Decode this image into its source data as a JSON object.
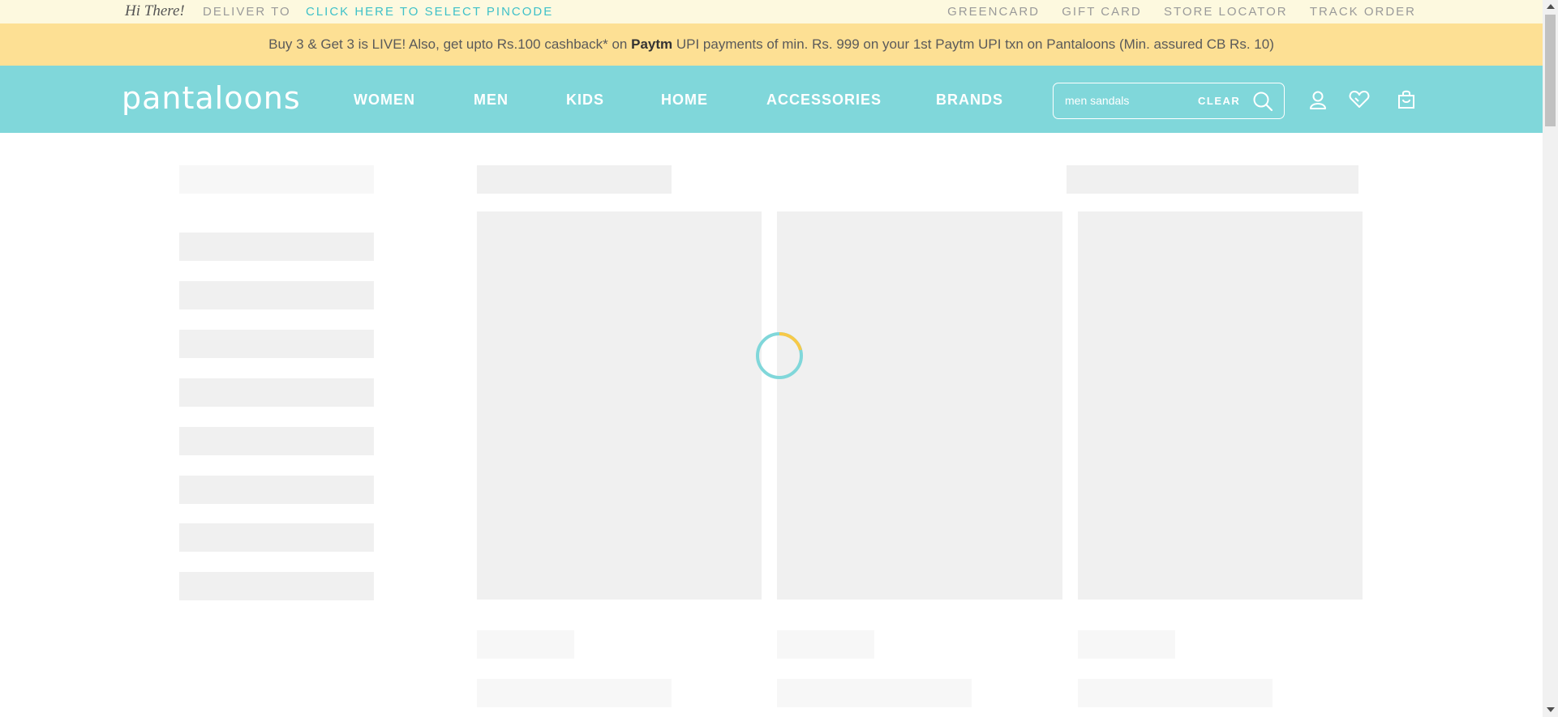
{
  "topbar": {
    "greeting": "Hi There!",
    "deliver_label": "DELIVER TO",
    "pincode_link": "CLICK HERE TO SELECT PINCODE",
    "links": [
      "GREENCARD",
      "GIFT CARD",
      "STORE LOCATOR",
      "TRACK ORDER"
    ]
  },
  "promo": {
    "text_before": "Buy 3 & Get 3 is LIVE! Also, get upto Rs.100 cashback* on ",
    "brand": "Paytm",
    "text_after": " UPI payments of min. Rs. 999 on your 1st Paytm UPI txn on Pantaloons (Min. assured CB Rs. 10)"
  },
  "header": {
    "logo": "pantaloons",
    "nav": [
      "WOMEN",
      "MEN",
      "KIDS",
      "HOME",
      "ACCESSORIES",
      "BRANDS"
    ],
    "search": {
      "value": "men sandals",
      "clear_label": "CLEAR"
    },
    "icons": [
      "search-icon",
      "user-icon",
      "wishlist-heart-icon",
      "shopping-bag-icon"
    ]
  },
  "colors": {
    "header_bg": "#80d7da",
    "promo_bg": "#fde094",
    "topbar_bg": "#fdf9df",
    "accent": "#3fc1c9",
    "skeleton": "#f0f0f0"
  },
  "loading": true
}
